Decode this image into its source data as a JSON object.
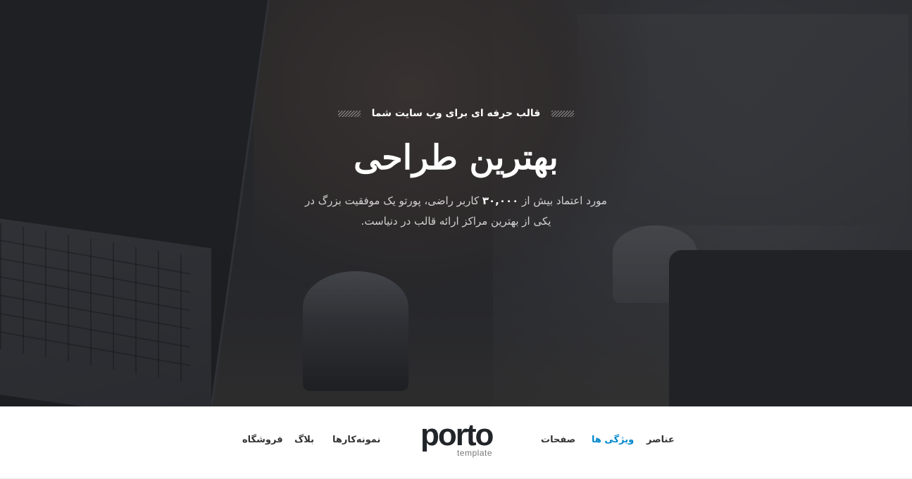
{
  "hero": {
    "tagline": "قالب حرفه ای برای وب سایت شما",
    "headline": "بهترین طراحی",
    "description_before": "مورد اعتماد بیش از ",
    "description_highlight": "۳۰,۰۰۰",
    "description_after": " کاربر راضی، پورتو یک موفقیت بزرگ در یکی از بهترین مراکز ارائه قالب در دنیاست."
  },
  "nav": {
    "left_items": [
      {
        "label": "فروشگاه"
      },
      {
        "label": "بلاگ"
      },
      {
        "label": "نمونه‌کارها"
      }
    ],
    "right_items": [
      {
        "label": "صفحات"
      },
      {
        "label": "ویژگی ها"
      },
      {
        "label": "عناصر"
      }
    ],
    "active_label": "ویژگی ها"
  },
  "logo": {
    "word": "porto",
    "sub": "template"
  },
  "colors": {
    "accent": "#0088cc",
    "nav_text": "#333333",
    "hero_overlay": "#1c1e21"
  }
}
